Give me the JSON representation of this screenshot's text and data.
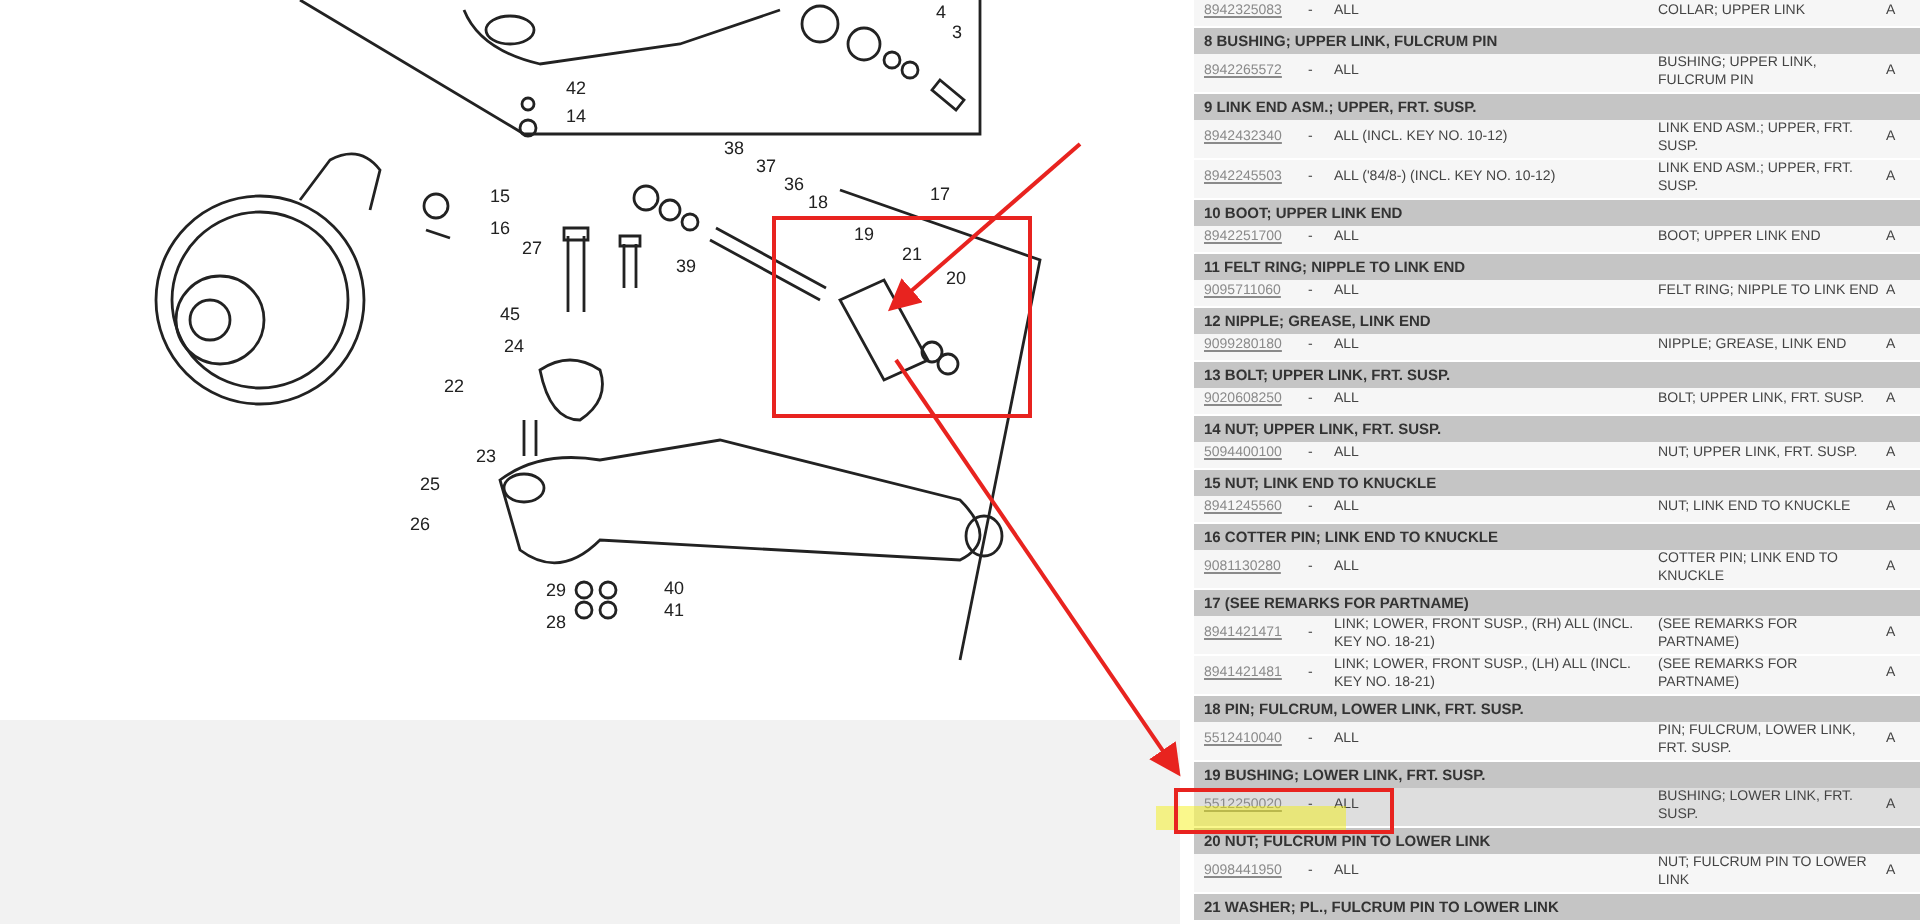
{
  "diagram": {
    "callouts": [
      "42",
      "14",
      "3",
      "4",
      "38",
      "37",
      "36",
      "15",
      "16",
      "27",
      "39",
      "18",
      "19",
      "17",
      "21",
      "20",
      "45",
      "24",
      "22",
      "23",
      "25",
      "26",
      "29",
      "40",
      "28",
      "41"
    ]
  },
  "sections": [
    {
      "parts": [
        {
          "part_no": "8942325083",
          "model": "-",
          "range": "ALL",
          "name": "COLLAR; UPPER LINK",
          "code": "A",
          "highlighted": false
        }
      ]
    },
    {
      "header": "8 BUSHING; UPPER LINK, FULCRUM PIN",
      "parts": [
        {
          "part_no": "8942265572",
          "model": "-",
          "range": "ALL",
          "name": "BUSHING; UPPER LINK, FULCRUM PIN",
          "code": "A",
          "highlighted": false
        }
      ]
    },
    {
      "header": "9 LINK END ASM.; UPPER, FRT. SUSP.",
      "parts": [
        {
          "part_no": "8942432340",
          "model": "-",
          "range": "ALL (INCL. KEY NO. 10-12)",
          "name": "LINK END ASM.; UPPER, FRT. SUSP.",
          "code": "A",
          "highlighted": false
        },
        {
          "part_no": "8942245503",
          "model": "-",
          "range": "ALL ('84/8-) (INCL. KEY NO. 10-12)",
          "name": "LINK END ASM.; UPPER, FRT. SUSP.",
          "code": "A",
          "highlighted": false
        }
      ]
    },
    {
      "header": "10 BOOT; UPPER LINK END",
      "parts": [
        {
          "part_no": "8942251700",
          "model": "-",
          "range": "ALL",
          "name": "BOOT; UPPER LINK END",
          "code": "A",
          "highlighted": false
        }
      ]
    },
    {
      "header": "11 FELT RING; NIPPLE TO LINK END",
      "parts": [
        {
          "part_no": "9095711060",
          "model": "-",
          "range": "ALL",
          "name": "FELT RING; NIPPLE TO LINK END",
          "code": "A",
          "highlighted": false
        }
      ]
    },
    {
      "header": "12 NIPPLE; GREASE, LINK END",
      "parts": [
        {
          "part_no": "9099280180",
          "model": "-",
          "range": "ALL",
          "name": "NIPPLE; GREASE, LINK END",
          "code": "A",
          "highlighted": false
        }
      ]
    },
    {
      "header": "13 BOLT; UPPER LINK, FRT. SUSP.",
      "parts": [
        {
          "part_no": "9020608250",
          "model": "-",
          "range": "ALL",
          "name": "BOLT; UPPER LINK, FRT. SUSP.",
          "code": "A",
          "highlighted": false
        }
      ]
    },
    {
      "header": "14 NUT; UPPER LINK, FRT. SUSP.",
      "parts": [
        {
          "part_no": "5094400100",
          "model": "-",
          "range": "ALL",
          "name": "NUT; UPPER LINK, FRT. SUSP.",
          "code": "A",
          "highlighted": false
        }
      ]
    },
    {
      "header": "15 NUT; LINK END TO KNUCKLE",
      "parts": [
        {
          "part_no": "8941245560",
          "model": "-",
          "range": "ALL",
          "name": "NUT; LINK END TO KNUCKLE",
          "code": "A",
          "highlighted": false
        }
      ]
    },
    {
      "header": "16 COTTER PIN; LINK END TO KNUCKLE",
      "parts": [
        {
          "part_no": "9081130280",
          "model": "-",
          "range": "ALL",
          "name": "COTTER PIN; LINK END TO KNUCKLE",
          "code": "A",
          "highlighted": false
        }
      ]
    },
    {
      "header": "17 (SEE REMARKS FOR PARTNAME)",
      "parts": [
        {
          "part_no": "8941421471",
          "model": "-",
          "range": "LINK; LOWER, FRONT SUSP., (RH) ALL (INCL. KEY NO. 18-21)",
          "name": "(SEE REMARKS FOR PARTNAME)",
          "code": "A",
          "highlighted": false
        },
        {
          "part_no": "8941421481",
          "model": "-",
          "range": "LINK; LOWER, FRONT SUSP., (LH) ALL (INCL. KEY NO. 18-21)",
          "name": "(SEE REMARKS FOR PARTNAME)",
          "code": "A",
          "highlighted": false
        }
      ]
    },
    {
      "header": "18 PIN; FULCRUM, LOWER LINK, FRT. SUSP.",
      "parts": [
        {
          "part_no": "5512410040",
          "model": "-",
          "range": "ALL",
          "name": "PIN; FULCRUM, LOWER LINK, FRT. SUSP.",
          "code": "A",
          "highlighted": false
        }
      ]
    },
    {
      "header": "19 BUSHING; LOWER LINK, FRT. SUSP.",
      "parts": [
        {
          "part_no": "5512250020",
          "model": "-",
          "range": "ALL",
          "name": "BUSHING; LOWER LINK, FRT. SUSP.",
          "code": "A",
          "highlighted": true
        }
      ]
    },
    {
      "header": "20 NUT; FULCRUM PIN TO LOWER LINK",
      "parts": [
        {
          "part_no": "9098441950",
          "model": "-",
          "range": "ALL",
          "name": "NUT; FULCRUM PIN TO LOWER LINK",
          "code": "A",
          "highlighted": false
        }
      ]
    },
    {
      "header": "21 WASHER; PL., FULCRUM PIN TO LOWER LINK"
    }
  ]
}
